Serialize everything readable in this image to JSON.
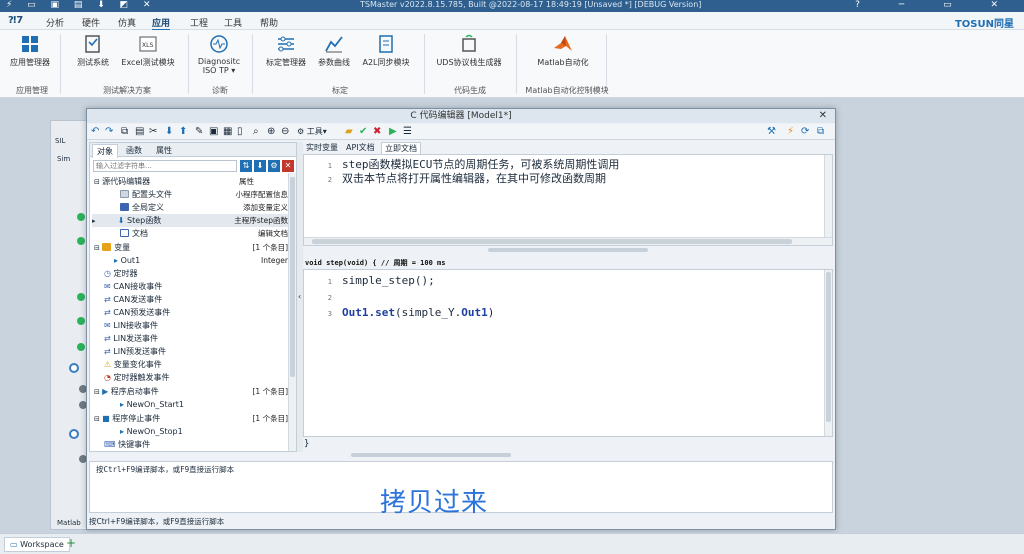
{
  "titlebar": {
    "title": "TSMaster v2022.8.15.785, Built @2022-08-17 18:49:19 [Unsaved *] [DEBUG Version]",
    "win_controls": [
      "?",
      "─",
      "▭",
      "✕"
    ]
  },
  "menubar": {
    "logo": "⁈7",
    "items": [
      "分析",
      "硬件",
      "仿真",
      "应用",
      "工程",
      "工具",
      "帮助"
    ],
    "active": "应用",
    "brand": "TOSUN同星"
  },
  "ribbon": {
    "buttons": [
      {
        "label": "应用管理器",
        "icon": "app-grid-icon"
      },
      {
        "label": "测试系统",
        "icon": "test-system-icon"
      },
      {
        "label": "Excel测试模块",
        "icon": "excel-icon"
      },
      {
        "label": "Diagnositc ISO TP ▾",
        "icon": "diagnostic-icon"
      },
      {
        "label": "标定管理器",
        "icon": "calibration-icon"
      },
      {
        "label": "参数曲线",
        "icon": "curve-icon"
      },
      {
        "label": "A2L同步模块",
        "icon": "a2l-icon"
      },
      {
        "label": "UDS协议栈生成器",
        "icon": "uds-icon"
      },
      {
        "label": "Matlab自动化",
        "icon": "matlab-icon"
      }
    ],
    "groups": [
      "应用管理",
      "测试解决方案",
      "诊断",
      "标定",
      "代码生成",
      "Matlab自动化控制模块"
    ]
  },
  "background": {
    "sil_label": "SIL",
    "sim_label": "Sim",
    "matlab_label": "Matlab"
  },
  "dialog": {
    "title": "C 代码编辑器 [Model1*]",
    "toolbar": {
      "tools_label": "⚙ 工具▾"
    },
    "left_tabs": [
      "对象",
      "函数",
      "属性"
    ],
    "filter_placeholder": "输入过滤字符串...",
    "tree": [
      {
        "label": "源代码编辑器",
        "right": "属性"
      },
      {
        "label": "配置头文件",
        "right": "小程序配置信息"
      },
      {
        "label": "全局定义",
        "right": "添加变量定义"
      },
      {
        "label": "Step函数",
        "right": "主程序step函数"
      },
      {
        "label": "文档",
        "right": "编辑文档"
      },
      {
        "label": "变量",
        "right": "[1 个条目]"
      },
      {
        "label": "Out1",
        "right": "Integer"
      },
      {
        "label": "定时器",
        "right": ""
      },
      {
        "label": "CAN接收事件",
        "right": ""
      },
      {
        "label": "CAN发送事件",
        "right": ""
      },
      {
        "label": "CAN预发送事件",
        "right": ""
      },
      {
        "label": "LIN接收事件",
        "right": ""
      },
      {
        "label": "LIN发送事件",
        "right": ""
      },
      {
        "label": "LIN预发送事件",
        "right": ""
      },
      {
        "label": "变量变化事件",
        "right": ""
      },
      {
        "label": "定时器触发事件",
        "right": ""
      },
      {
        "label": "程序启动事件",
        "right": "[1 个条目]"
      },
      {
        "label": "NewOn_Start1",
        "right": ""
      },
      {
        "label": "程序停止事件",
        "right": "[1 个条目]"
      },
      {
        "label": "NewOn_Stop1",
        "right": ""
      },
      {
        "label": "快键事件",
        "right": ""
      }
    ],
    "editor_tabs": [
      "实时变量",
      "API文档",
      "立即文档"
    ],
    "doc_lines": [
      {
        "num": "1",
        "text": "step函数模拟ECU节点的周期任务，可被系统周期性调用"
      },
      {
        "num": "2",
        "text": "双击本节点将打开属性编辑器，在其中可修改函数周期"
      }
    ],
    "signature": "void step(void) { // 周期 = 100 ms",
    "code_lines": [
      {
        "num": "1",
        "code": "simple_step();"
      },
      {
        "num": "2",
        "code": ""
      },
      {
        "num": "3",
        "code_kw": "Out1.set",
        "code_rest": "(simple_Y.",
        "code_kw2": "Out1",
        "code_end": ")"
      }
    ],
    "closing_brace": "}",
    "console_msg": "按Ctrl+F9编译脚本，或F9直接运行脚本",
    "status_msg": "按Ctrl+F9编译脚本，或F9直接运行脚本"
  },
  "subtitle": "拷贝过来",
  "bottombar": {
    "workspace_tab": "Workspace",
    "add": "+"
  },
  "colors": {
    "accent": "#1f6fb2",
    "title_bg": "#2e5f8e",
    "subtitle": "#2c74d9",
    "keyword": "#1d3fa0",
    "green_node": "#2bb35a"
  }
}
